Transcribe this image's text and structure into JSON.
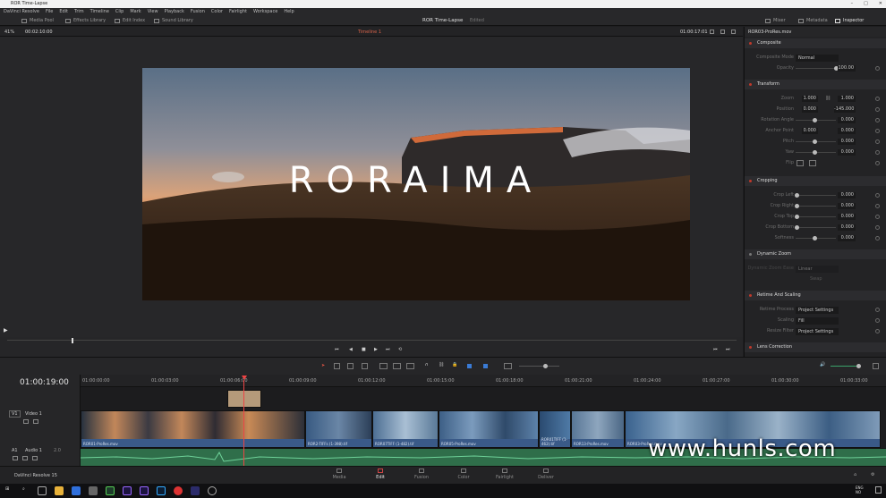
{
  "window": {
    "title": "ROR Time-Lapse",
    "controls": [
      "–",
      "□",
      "✕"
    ]
  },
  "menu": [
    "DaVinci Resolve",
    "File",
    "Edit",
    "Trim",
    "Timeline",
    "Clip",
    "Mark",
    "View",
    "Playback",
    "Fusion",
    "Color",
    "Fairlight",
    "Workspace",
    "Help"
  ],
  "toolbar": {
    "media_pool": "Media Pool",
    "effects_library": "Effects Library",
    "edit_index": "Edit Index",
    "sound_library": "Sound Library",
    "project_title": "ROR Time-Lapse",
    "edited": "Edited",
    "mixer": "Mixer",
    "metadata": "Metadata",
    "inspector": "Inspector"
  },
  "viewer": {
    "zoom": "41%",
    "source_tc": "00:02:10:00",
    "timeline_name": "Timeline 1",
    "record_tc": "01:00:17:01",
    "title_text": "RORAIMA"
  },
  "inspector": {
    "clip_name": "ROR03-ProRes.mov",
    "composite": {
      "header": "Composite",
      "mode_label": "Composite Mode",
      "mode_value": "Normal",
      "opacity_label": "Opacity",
      "opacity_value": "100.00"
    },
    "transform": {
      "header": "Transform",
      "zoom_label": "Zoom",
      "zoom_x": "1.000",
      "zoom_y": "1.000",
      "position_label": "Position",
      "pos_x": "0.000",
      "pos_y": "-145.000",
      "rotation_label": "Rotation Angle",
      "rotation": "0.000",
      "anchor_label": "Anchor Point",
      "anchor_x": "0.000",
      "anchor_y": "0.000",
      "pitch_label": "Pitch",
      "pitch": "0.000",
      "yaw_label": "Yaw",
      "yaw": "0.000",
      "flip_label": "Flip"
    },
    "cropping": {
      "header": "Cropping",
      "left_label": "Crop Left",
      "left": "0.000",
      "right_label": "Crop Right",
      "right": "0.000",
      "top_label": "Crop Top",
      "top": "0.000",
      "bottom_label": "Crop Bottom",
      "bottom": "0.000",
      "soft_label": "Softness",
      "soft": "0.000"
    },
    "dynamic_zoom": {
      "header": "Dynamic Zoom",
      "ease_label": "Dynamic Zoom Ease",
      "ease_value": "Linear",
      "swap": "Swap"
    },
    "retime": {
      "header": "Retime And Scaling",
      "process_label": "Retime Process",
      "process_value": "Project Settings",
      "scaling_label": "Scaling",
      "scaling_value": "Fill",
      "resize_label": "Resize Filter",
      "resize_value": "Project Settings"
    },
    "lens": {
      "header": "Lens Correction"
    }
  },
  "timeline": {
    "timecode": "01:00:19:00",
    "ruler": [
      "01:00:00:00",
      "01:00:03:00",
      "01:00:06:00",
      "01:00:09:00",
      "01:00:12:00",
      "01:00:15:00",
      "01:00:18:00",
      "01:00:21:00",
      "01:00:24:00",
      "01:00:27:00",
      "01:00:30:00",
      "01:00:33:00",
      "01:00:36:00"
    ],
    "video_track": {
      "id": "V1",
      "name": "Video 1"
    },
    "audio_track": {
      "id": "A1",
      "name": "Audio 1",
      "level": "2.0"
    },
    "clips": [
      "ROR01-ProRes.mov",
      "ROR2-TIFFs (1-398).tif",
      "ROR07TIFF (1-482).tif",
      "ROR05-ProRes.mov",
      "ROR01TIFF (1-462).tif",
      "ROR13-ProRes.mov",
      "ROR03-ProRes.mov"
    ]
  },
  "pages": [
    "Media",
    "Edit",
    "Fusion",
    "Color",
    "Fairlight",
    "Deliver"
  ],
  "app_name": "DaVinci Resolve 15",
  "taskbar": {
    "lang": "ENG",
    "region": "NO"
  },
  "watermark": "www.hunls.com"
}
